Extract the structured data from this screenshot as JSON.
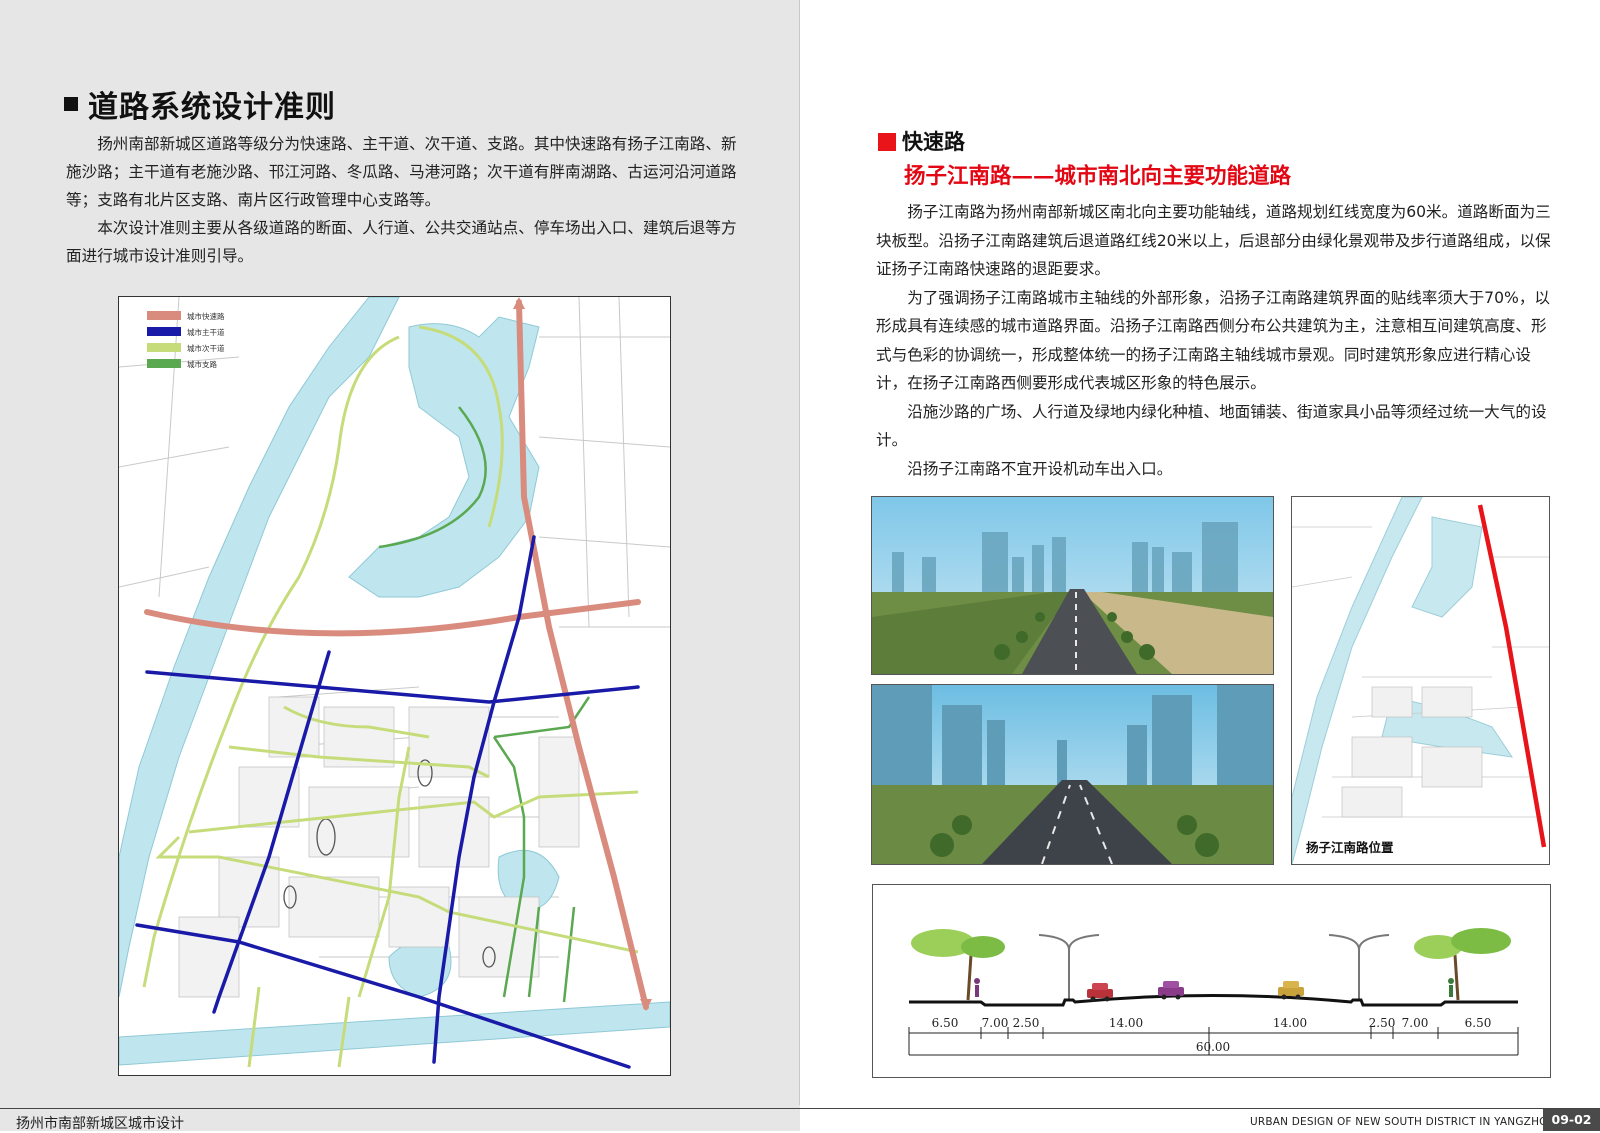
{
  "left": {
    "title": "道路系统设计准则",
    "intro": [
      "扬州南部新城区道路等级分为快速路、主干道、次干道、支路。其中快速路有扬子江南路、新施沙路；主干道有老施沙路、邗江河路、冬瓜路、马港河路；次干道有胖南湖路、古运河沿河道路等；支路有北片区支路、南片区行政管理中心支路等。",
      "本次设计准则主要从各级道路的断面、人行道、公共交通站点、停车场出入口、建筑后退等方面进行城市设计准则引导。"
    ],
    "legend": [
      {
        "label": "城市快速路",
        "color": "#d98b7e"
      },
      {
        "label": "城市主干道",
        "color": "#1a1aa8"
      },
      {
        "label": "城市次干道",
        "color": "#c6dc7a"
      },
      {
        "label": "城市支路",
        "color": "#5aa850"
      }
    ]
  },
  "right": {
    "section_title": "快速路",
    "subtitle": "扬子江南路——城市南北向主要功能道路",
    "paragraphs": [
      "扬子江南路为扬州南部新城区南北向主要功能轴线，道路规划红线宽度为60米。道路断面为三块板型。沿扬子江南路建筑后退道路红线20米以上，后退部分由绿化景观带及步行道路组成，以保证扬子江南路快速路的退距要求。",
      "为了强调扬子江南路城市主轴线的外部形象，沿扬子江南路建筑界面的贴线率须大于70%，以形成具有连续感的城市道路界面。沿扬子江南路西侧分布公共建筑为主，注意相互间建筑高度、形式与色彩的协调统一，形成整体统一的扬子江南路主轴线城市景观。同时建筑形象应进行精心设计，在扬子江南路西侧要形成代表城区形象的特色展示。",
      "沿施沙路的广场、人行道及绿地内绿化种植、地面铺装、街道家具小品等须经过统一大气的设计。",
      "沿扬子江南路不宜开设机动车出入口。"
    ],
    "location_label": "扬子江南路位置",
    "section_dims": [
      "6.50",
      "7.00",
      "2.50",
      "14.00",
      "14.00",
      "2.50",
      "7.00",
      "6.50"
    ],
    "section_total": "60.00"
  },
  "footer": {
    "left": "扬州市南部新城区城市设计",
    "right": "URBAN DESIGN OF NEW SOUTH DISTRICT IN YANGZHOU",
    "page": "09-02"
  },
  "colors": {
    "expressway": "#d98b7e",
    "arterial": "#1a1aa8",
    "secondary": "#c6dc7a",
    "branch": "#5aa850",
    "water": "#bfe6ee",
    "accent_red": "#e30613"
  }
}
